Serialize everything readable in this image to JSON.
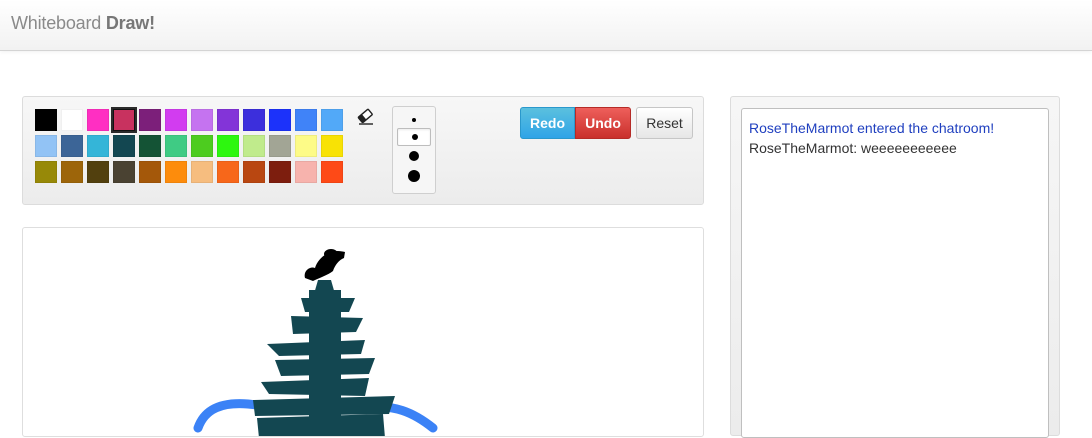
{
  "navbar": {
    "brand_light": "Whiteboard",
    "brand_bold": "Draw!"
  },
  "palette": {
    "colors": [
      "#000000",
      "#ffffff",
      "#ff2fc2",
      "#c8325f",
      "#7c1f7a",
      "#d23cf0",
      "#c573f0",
      "#8334d8",
      "#3c2fdc",
      "#1c32fa",
      "#4083f8",
      "#52a9f8",
      "#92c3f5",
      "#3c6597",
      "#34b5d8",
      "#134751",
      "#145335",
      "#3fcb84",
      "#4dcc1f",
      "#2df70f",
      "#c0eb8c",
      "#a2a595",
      "#fdfb87",
      "#f8e205",
      "#978908",
      "#9d650a",
      "#52400e",
      "#4a4232",
      "#a4580a",
      "#fd8c0c",
      "#f6bd7f",
      "#f7671a",
      "#b94711",
      "#7d1e0e",
      "#f7b3ad",
      "#fe4a17"
    ],
    "selected_index": 3
  },
  "tools": {
    "eraser_icon": "eraser-icon",
    "brush_sizes": [
      "small",
      "medium",
      "large",
      "extra-large"
    ],
    "selected_size": "medium"
  },
  "buttons": {
    "redo": "Redo",
    "undo": "Undo",
    "reset": "Reset"
  },
  "chat": {
    "messages": [
      {
        "type": "system",
        "text": "RoseTheMarmot entered the chatroom!"
      },
      {
        "type": "user",
        "text": "RoseTheMarmot: weeeeeeeeeee"
      }
    ]
  },
  "colors": {
    "system_message": "#1f3fbf",
    "redo_button": "#2fa4e7",
    "undo_button": "#c9302c",
    "tree_green": "#134751",
    "river_blue": "#3b82f6"
  }
}
